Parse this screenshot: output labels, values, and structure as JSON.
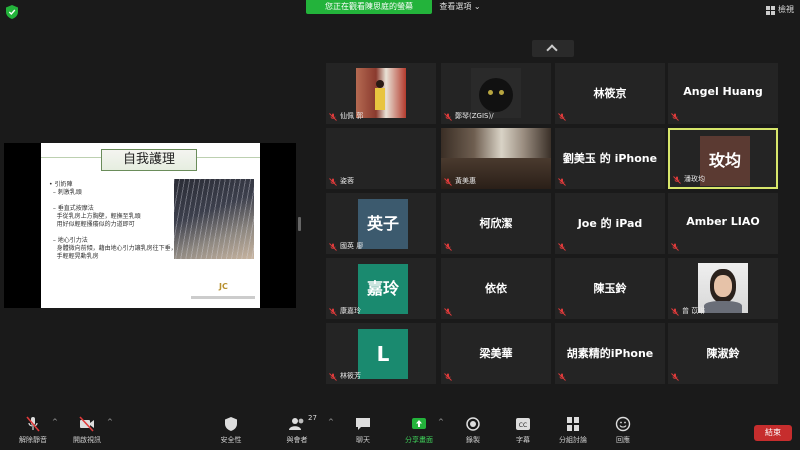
{
  "top": {
    "banner": "您正在觀看陳思庭的螢幕",
    "view_options": "查看選項 ⌄",
    "view": "檢視"
  },
  "slide": {
    "title": "自我護理",
    "lines": [
      "• 引奶陣",
      "  – 刺激乳頭",
      "",
      "  – 垂直式按摩法",
      "    手從乳房上方胸壁，輕撫至乳頭",
      "    用好似輕輕搔癢似的力道即可",
      "",
      "  – 地心引力法",
      "    身體微向前傾，藉由地心引力讓乳房往下垂，然後用",
      "    手輕輕晃動乳房"
    ],
    "logo": "JC"
  },
  "participants": [
    {
      "name": "仙佩 郭",
      "display": "",
      "type": "photo"
    },
    {
      "name": "鄭琴(ZGIS)/",
      "display": "",
      "type": "photo"
    },
    {
      "name": "",
      "display": "林筱京",
      "type": "name"
    },
    {
      "name": "",
      "display": "Angel Huang",
      "type": "name"
    },
    {
      "name": "姿蓉",
      "display": "",
      "type": "blank"
    },
    {
      "name": "黃美惠",
      "display": "",
      "type": "photo"
    },
    {
      "name": "",
      "display": "劉美玉 的 iPhone",
      "type": "name"
    },
    {
      "name": "潘玫均",
      "display": "玫均",
      "type": "avatar",
      "color": "#5b3a32"
    },
    {
      "name": "國英 廖",
      "display": "英子",
      "type": "avatar",
      "color": "#3c5a6e"
    },
    {
      "name": "",
      "display": "柯欣潔",
      "type": "name"
    },
    {
      "name": "",
      "display": "Joe 的 iPad",
      "type": "name"
    },
    {
      "name": "",
      "display": "Amber LIAO",
      "type": "name"
    },
    {
      "name": "康嘉玲",
      "display": "嘉玲",
      "type": "avatar",
      "color": "#1a8a6f"
    },
    {
      "name": "",
      "display": "依依",
      "type": "name"
    },
    {
      "name": "",
      "display": "陳玉鈴",
      "type": "name"
    },
    {
      "name": "曾 苡琳",
      "display": "",
      "type": "photo"
    },
    {
      "name": "林筱芳",
      "display": "L",
      "type": "avatar",
      "color": "#1a8a6f"
    },
    {
      "name": "",
      "display": "梁美華",
      "type": "name"
    },
    {
      "name": "",
      "display": "胡素精的iPhone",
      "type": "name"
    },
    {
      "name": "",
      "display": "陳淑鈴",
      "type": "name"
    }
  ],
  "toolbar": {
    "unmute": "解除靜音",
    "start_video": "開啟視訊",
    "security": "安全性",
    "participants": "與會者",
    "participants_count": "27",
    "chat": "聊天",
    "share_screen": "分享畫面",
    "record": "錄製",
    "captions": "字幕",
    "breakout": "分組討論",
    "reactions": "回應",
    "end": "結束"
  },
  "colors": {
    "accent_green": "#23b33b",
    "end_red": "#c62d2d",
    "active_speaker": "#d7e66b"
  }
}
